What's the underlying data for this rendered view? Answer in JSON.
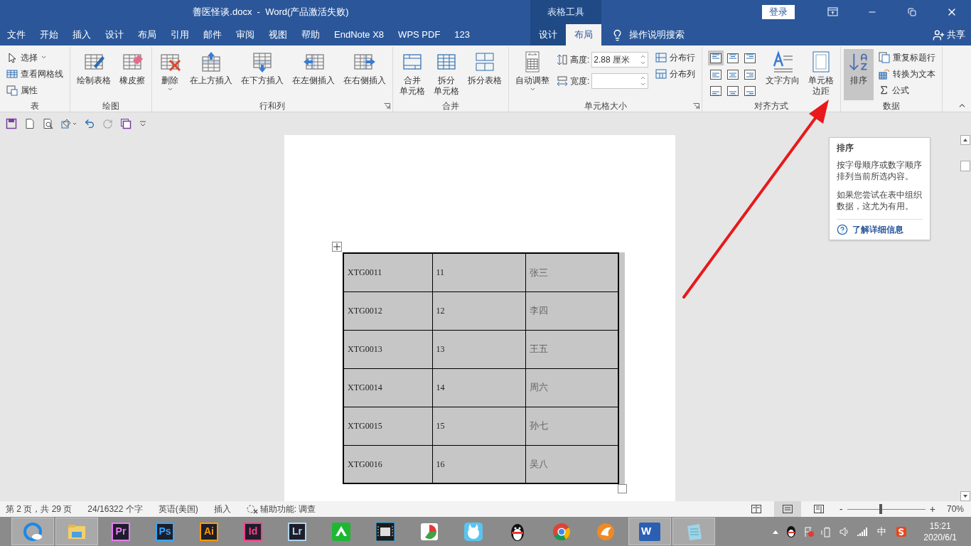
{
  "window": {
    "title": "善医怪谈.docx  -  Word(产品激活失败)",
    "context_label": "表格工具",
    "sign_in": "登录"
  },
  "tabs": [
    {
      "label": "文件",
      "selected": false
    },
    {
      "label": "开始",
      "selected": false
    },
    {
      "label": "插入",
      "selected": false
    },
    {
      "label": "设计",
      "selected": false
    },
    {
      "label": "布局",
      "selected": false
    },
    {
      "label": "引用",
      "selected": false
    },
    {
      "label": "邮件",
      "selected": false
    },
    {
      "label": "审阅",
      "selected": false
    },
    {
      "label": "视图",
      "selected": false
    },
    {
      "label": "帮助",
      "selected": false
    },
    {
      "label": "EndNote X8",
      "selected": false
    },
    {
      "label": "WPS PDF",
      "selected": false
    },
    {
      "label": "123",
      "selected": false
    }
  ],
  "context_tabs": [
    {
      "label": "设计",
      "selected": false
    },
    {
      "label": "布局",
      "selected": true
    }
  ],
  "tell_me": "操作说明搜索",
  "share": "共享",
  "ribbon": {
    "groups": [
      {
        "label": "表",
        "items": [
          {
            "kind": "small",
            "label": "选择",
            "dropdown": true
          },
          {
            "kind": "small",
            "label": "查看网格线"
          },
          {
            "kind": "small",
            "label": "属性"
          }
        ]
      },
      {
        "label": "绘图",
        "items": [
          {
            "kind": "large",
            "lines": [
              "绘制表格"
            ]
          },
          {
            "kind": "large",
            "lines": [
              "橡皮擦"
            ]
          }
        ]
      },
      {
        "label": "行和列",
        "launcher": true,
        "items": [
          {
            "kind": "large",
            "lines": [
              "删除"
            ],
            "dropdown": true
          },
          {
            "kind": "large",
            "lines": [
              "在上方插入"
            ]
          },
          {
            "kind": "large",
            "lines": [
              "在下方插入"
            ]
          },
          {
            "kind": "large",
            "lines": [
              "在左侧插入"
            ]
          },
          {
            "kind": "large",
            "lines": [
              "在右侧插入"
            ]
          }
        ]
      },
      {
        "label": "合并",
        "items": [
          {
            "kind": "large",
            "lines": [
              "合并",
              "单元格"
            ]
          },
          {
            "kind": "large",
            "lines": [
              "拆分",
              "单元格"
            ]
          },
          {
            "kind": "large",
            "lines": [
              "拆分表格"
            ]
          }
        ]
      },
      {
        "label": "单元格大小",
        "launcher": true,
        "items": [
          {
            "kind": "large",
            "lines": [
              "自动调整"
            ],
            "dropdown": true
          },
          {
            "kind": "spinner",
            "label": "高度:",
            "value": "2.88 厘米"
          },
          {
            "kind": "spinner",
            "label": "宽度:"
          },
          {
            "kind": "small",
            "label": "分布行"
          },
          {
            "kind": "small",
            "label": "分布列"
          }
        ]
      },
      {
        "label": "对齐方式",
        "items": [
          {
            "kind": "align",
            "cells": [
              {
                "selected": true
              },
              {
                "selected": false
              },
              {
                "selected": false
              },
              {
                "selected": false
              },
              {
                "selected": false
              },
              {
                "selected": false
              },
              {
                "selected": false
              },
              {
                "selected": false
              },
              {
                "selected": false
              }
            ]
          },
          {
            "kind": "large",
            "lines": [
              "文字方向"
            ]
          },
          {
            "kind": "large",
            "lines": [
              "单元格",
              "边距"
            ]
          }
        ]
      },
      {
        "label": "数据",
        "items": [
          {
            "kind": "large",
            "lines": [
              "排序"
            ],
            "highlighted": true
          },
          {
            "kind": "small",
            "label": "重复标题行"
          },
          {
            "kind": "small",
            "label": "转换为文本"
          },
          {
            "kind": "small",
            "label": "公式"
          }
        ]
      }
    ]
  },
  "document": {
    "table": {
      "selected": true,
      "rows": [
        [
          "XTG0011",
          "11",
          "张三"
        ],
        [
          "XTG0012",
          "12",
          "李四"
        ],
        [
          "XTG0013",
          "13",
          "王五"
        ],
        [
          "XTG0014",
          "14",
          "周六"
        ],
        [
          "XTG0015",
          "15",
          "孙七"
        ],
        [
          "XTG0016",
          "16",
          "吴八"
        ]
      ]
    }
  },
  "tooltip": {
    "title": "排序",
    "paragraphs": [
      "按字母顺序或数字顺序排列当前所选内容。",
      "如果您尝试在表中组织数据，这尤为有用。"
    ],
    "link": "了解详细信息"
  },
  "status_bar": {
    "items": [
      "第 2 页，共 29 页",
      "24/16322 个字",
      "英语(美国)",
      "插入"
    ],
    "accessibility": "辅助功能: 调查",
    "views": [
      {
        "selected": false
      },
      {
        "selected": true
      },
      {
        "selected": false
      }
    ],
    "zoom_out": "-",
    "zoom": {
      "level": 0.43
    },
    "zoom_in": "+",
    "zoom_label": "70%"
  },
  "taskbar": {
    "apps": [
      {
        "kind": "browser",
        "running": true
      },
      {
        "kind": "folder",
        "running": true
      },
      {
        "kind": "badge",
        "label": "Pr",
        "color": "#e77cf3",
        "running": false
      },
      {
        "kind": "badge",
        "label": "Ps",
        "color": "#31a8ff",
        "running": false
      },
      {
        "kind": "badge",
        "label": "Ai",
        "color": "#ff9a00",
        "running": false
      },
      {
        "kind": "badge",
        "label": "Id",
        "color": "#ff3d8b",
        "running": false
      },
      {
        "kind": "badge",
        "label": "Lr",
        "color": "#add5ec",
        "running": false
      },
      {
        "kind": "cube",
        "running": false
      },
      {
        "kind": "film",
        "running": false
      },
      {
        "kind": "pie",
        "running": false
      },
      {
        "kind": "cat",
        "running": false
      },
      {
        "kind": "penguin",
        "running": false
      },
      {
        "kind": "chrome",
        "running": false
      },
      {
        "kind": "fox",
        "running": false
      },
      {
        "kind": "word",
        "label": "W",
        "running": true
      },
      {
        "kind": "notepad",
        "running": true
      }
    ],
    "tray": {
      "ime": "中",
      "time": "15:21",
      "date": "2020/6/1"
    }
  }
}
